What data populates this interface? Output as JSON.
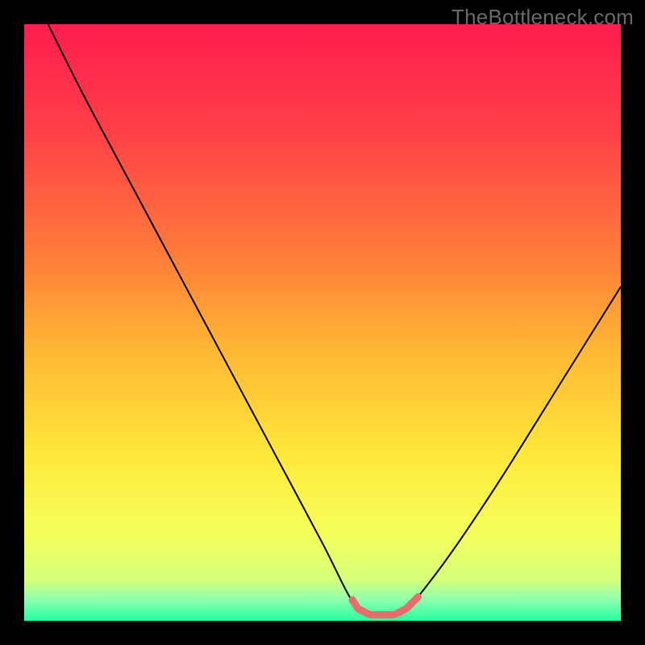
{
  "watermark": "TheBottleneck.com",
  "colors": {
    "frame": "#000000",
    "curve": "#000000",
    "highlight": "#e86d6d",
    "gradient_stops": [
      {
        "offset": 0.0,
        "color": "#ff1d4d"
      },
      {
        "offset": 0.18,
        "color": "#ff4048"
      },
      {
        "offset": 0.38,
        "color": "#ff7a3a"
      },
      {
        "offset": 0.55,
        "color": "#ffb834"
      },
      {
        "offset": 0.72,
        "color": "#ffe83a"
      },
      {
        "offset": 0.85,
        "color": "#f6ff5a"
      },
      {
        "offset": 0.93,
        "color": "#d7ff7a"
      },
      {
        "offset": 0.965,
        "color": "#8dffb0"
      },
      {
        "offset": 1.0,
        "color": "#26ff9e"
      }
    ]
  },
  "chart_data": {
    "type": "line",
    "title": "",
    "xlabel": "",
    "ylabel": "",
    "xlim": [
      0,
      100
    ],
    "ylim": [
      0,
      100
    ],
    "series": [
      {
        "name": "bottleneck-curve",
        "x": [
          4,
          10,
          18,
          26,
          34,
          42,
          50,
          54,
          56,
          58,
          60,
          62,
          64,
          66,
          72,
          80,
          90,
          100
        ],
        "y": [
          100,
          88,
          73,
          58,
          43,
          28,
          13,
          5,
          2,
          1,
          1,
          1,
          2,
          4,
          12,
          24,
          40,
          56
        ]
      }
    ],
    "highlight_range_x": [
      55,
      66
    ],
    "notes": "y axis = bottleneck severity percent (approx. from color gradient), 0 at bottom green band, 100 at top red; x axis = component balance axis (arbitrary units 0-100). Curve shows a V/valley shape with minimum ~1% around x≈58-62."
  }
}
